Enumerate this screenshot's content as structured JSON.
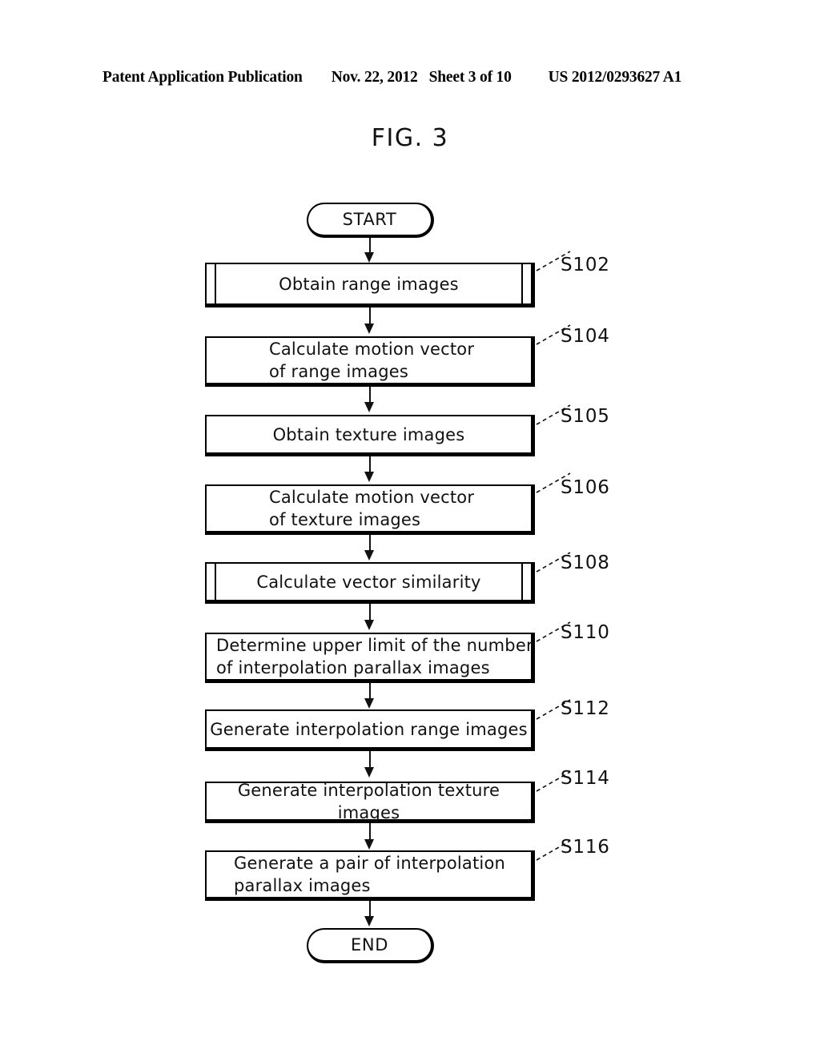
{
  "header": {
    "publication": "Patent Application Publication",
    "date": "Nov. 22, 2012",
    "sheet": "Sheet 3 of 10",
    "number": "US 2012/0293627 A1"
  },
  "figure": {
    "title": "FIG. 3"
  },
  "flowchart": {
    "start_label": "START",
    "end_label": "END",
    "steps": [
      {
        "id": "S102",
        "text": "Obtain range images",
        "shape": "predefined-process",
        "align": "center"
      },
      {
        "id": "S104",
        "text": "Calculate motion vector\nof range images",
        "shape": "process",
        "align": "left"
      },
      {
        "id": "S105",
        "text": "Obtain texture images",
        "shape": "process",
        "align": "center"
      },
      {
        "id": "S106",
        "text": "Calculate motion vector\nof texture images",
        "shape": "process",
        "align": "left"
      },
      {
        "id": "S108",
        "text": "Calculate vector similarity",
        "shape": "predefined-process",
        "align": "center"
      },
      {
        "id": "S110",
        "text": "Determine upper limit of the number\nof interpolation parallax images",
        "shape": "process",
        "align": "left"
      },
      {
        "id": "S112",
        "text": "Generate interpolation range images",
        "shape": "process",
        "align": "center"
      },
      {
        "id": "S114",
        "text": "Generate interpolation texture images",
        "shape": "process",
        "align": "center"
      },
      {
        "id": "S116",
        "text": "Generate a pair of interpolation\nparallax images",
        "shape": "process",
        "align": "left"
      }
    ]
  },
  "colors": {
    "ink": "#111111",
    "paper": "#ffffff"
  }
}
